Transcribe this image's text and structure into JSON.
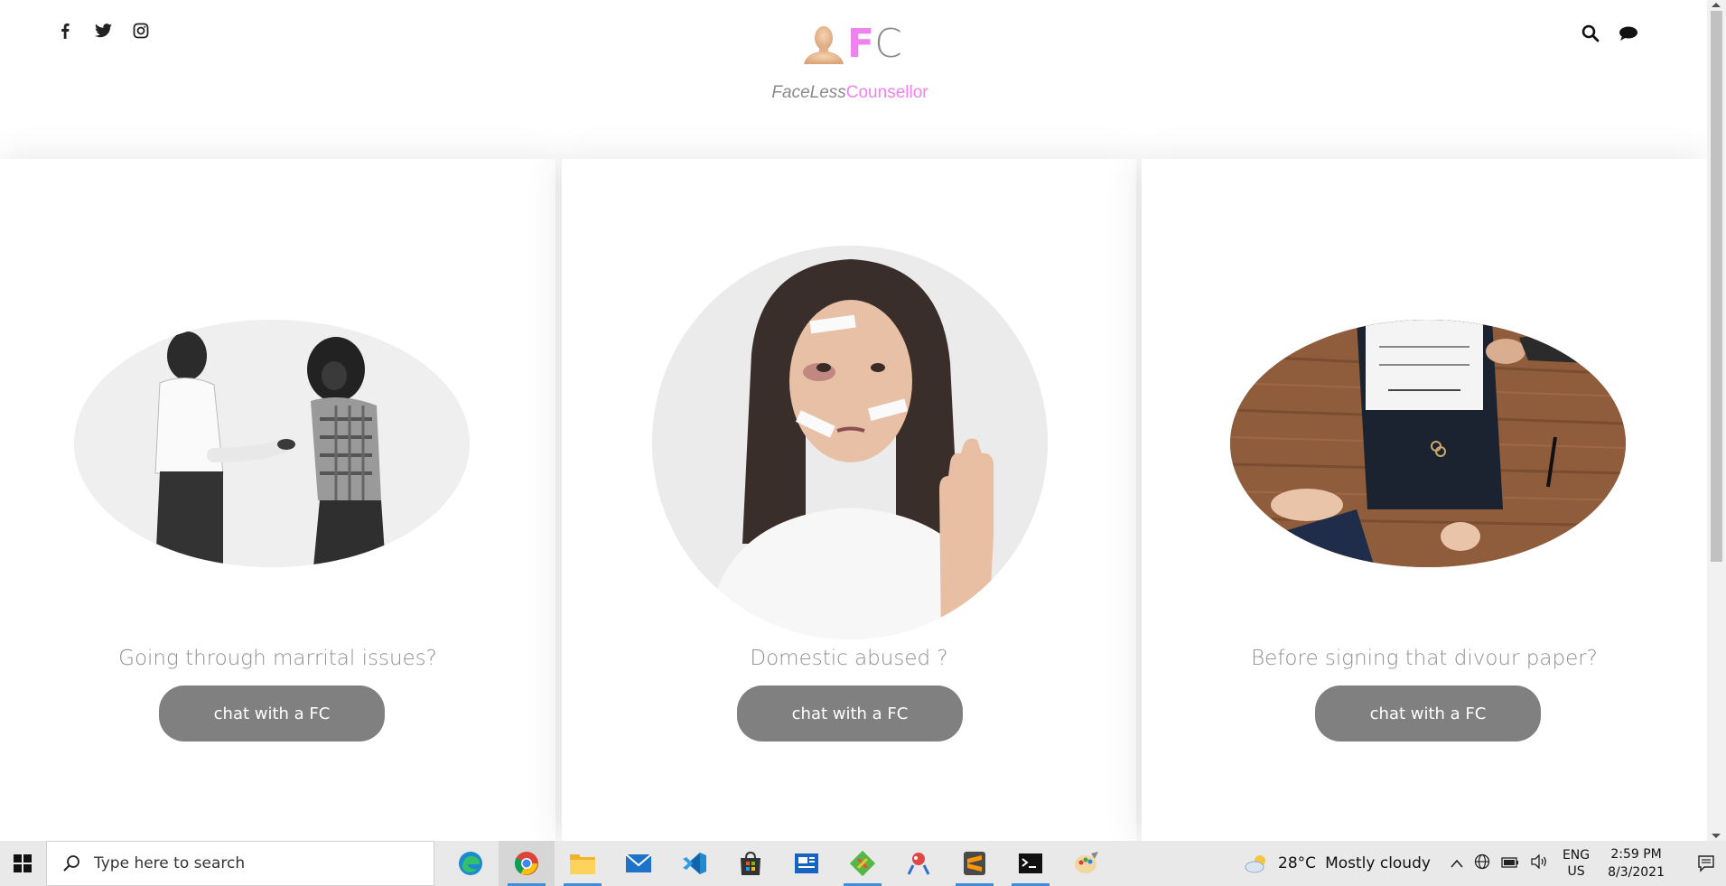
{
  "header": {
    "social": [
      "facebook-icon",
      "twitter-icon",
      "instagram-icon"
    ],
    "logo": {
      "letter1": "F",
      "letter2": "C"
    },
    "tagline": {
      "part1": "FaceLess",
      "part2": "Counsellor"
    },
    "right_icons": [
      "search-icon",
      "chat-icon"
    ]
  },
  "cards": [
    {
      "question": "Going through marrital issues?",
      "button": "chat with a FC",
      "image": "couple-argument-photo"
    },
    {
      "question": "Domestic abused ?",
      "button": "chat with a FC",
      "image": "abused-woman-photo"
    },
    {
      "question": "Before signing that divour paper?",
      "button": "chat with a FC",
      "image": "divorce-paper-photo"
    }
  ],
  "taskbar": {
    "search_placeholder": "Type here to search",
    "apps": [
      "edge-icon",
      "chrome-icon",
      "file-explorer-icon",
      "mail-icon",
      "vscode-icon",
      "store-icon",
      "news-icon",
      "git-icon",
      "snip-icon",
      "sublime-icon",
      "terminal-icon",
      "paint-icon"
    ],
    "weather": {
      "temp": "28°C",
      "condition": "Mostly cloudy"
    },
    "language": {
      "lang": "ENG",
      "region": "US"
    },
    "clock": {
      "time": "2:59 PM",
      "date": "8/3/2021"
    }
  },
  "colors": {
    "accent": "#ee82ee",
    "button": "#808080",
    "text_gray": "#8f8f8f"
  }
}
